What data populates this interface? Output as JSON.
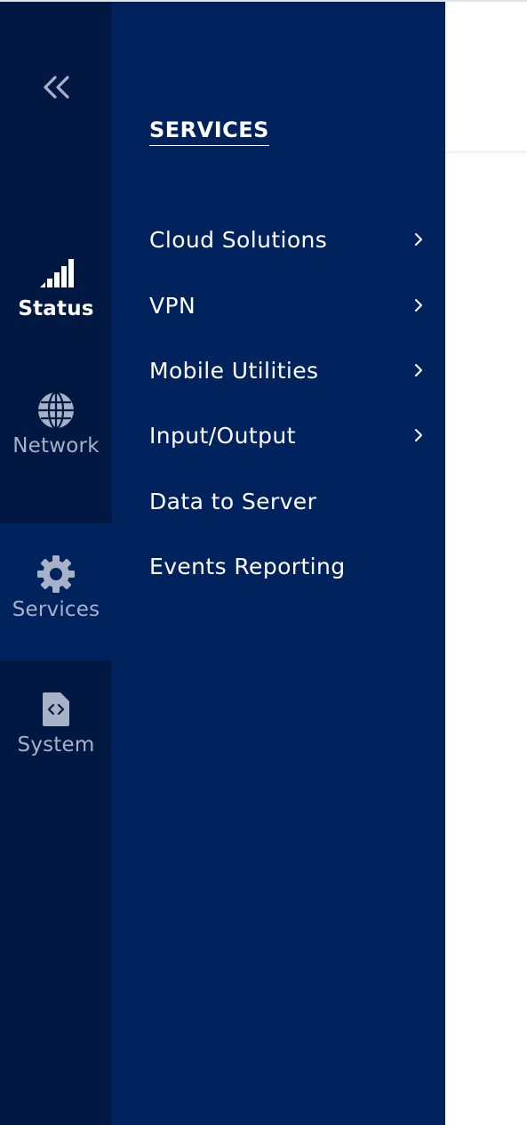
{
  "rail": {
    "collapse_icon": "double-chevron-left-icon",
    "items": [
      {
        "label": "Status",
        "icon": "signal-bars-icon",
        "active": false
      },
      {
        "label": "Network",
        "icon": "globe-icon",
        "active": false
      },
      {
        "label": "Services",
        "icon": "gear-icon",
        "active": true
      },
      {
        "label": "System",
        "icon": "code-file-icon",
        "active": false
      }
    ]
  },
  "submenu": {
    "title": "SERVICES",
    "items": [
      {
        "label": "Cloud Solutions",
        "has_children": true
      },
      {
        "label": "VPN",
        "has_children": true
      },
      {
        "label": "Mobile Utilities",
        "has_children": true
      },
      {
        "label": "Input/Output",
        "has_children": true
      },
      {
        "label": "Data to Server",
        "has_children": false
      },
      {
        "label": "Events Reporting",
        "has_children": false
      }
    ]
  },
  "colors": {
    "rail_bg": "#001842",
    "panel_bg": "#00235e",
    "active_bg": "#00235e",
    "muted_text": "#a7b1c8",
    "text": "#ffffff"
  }
}
